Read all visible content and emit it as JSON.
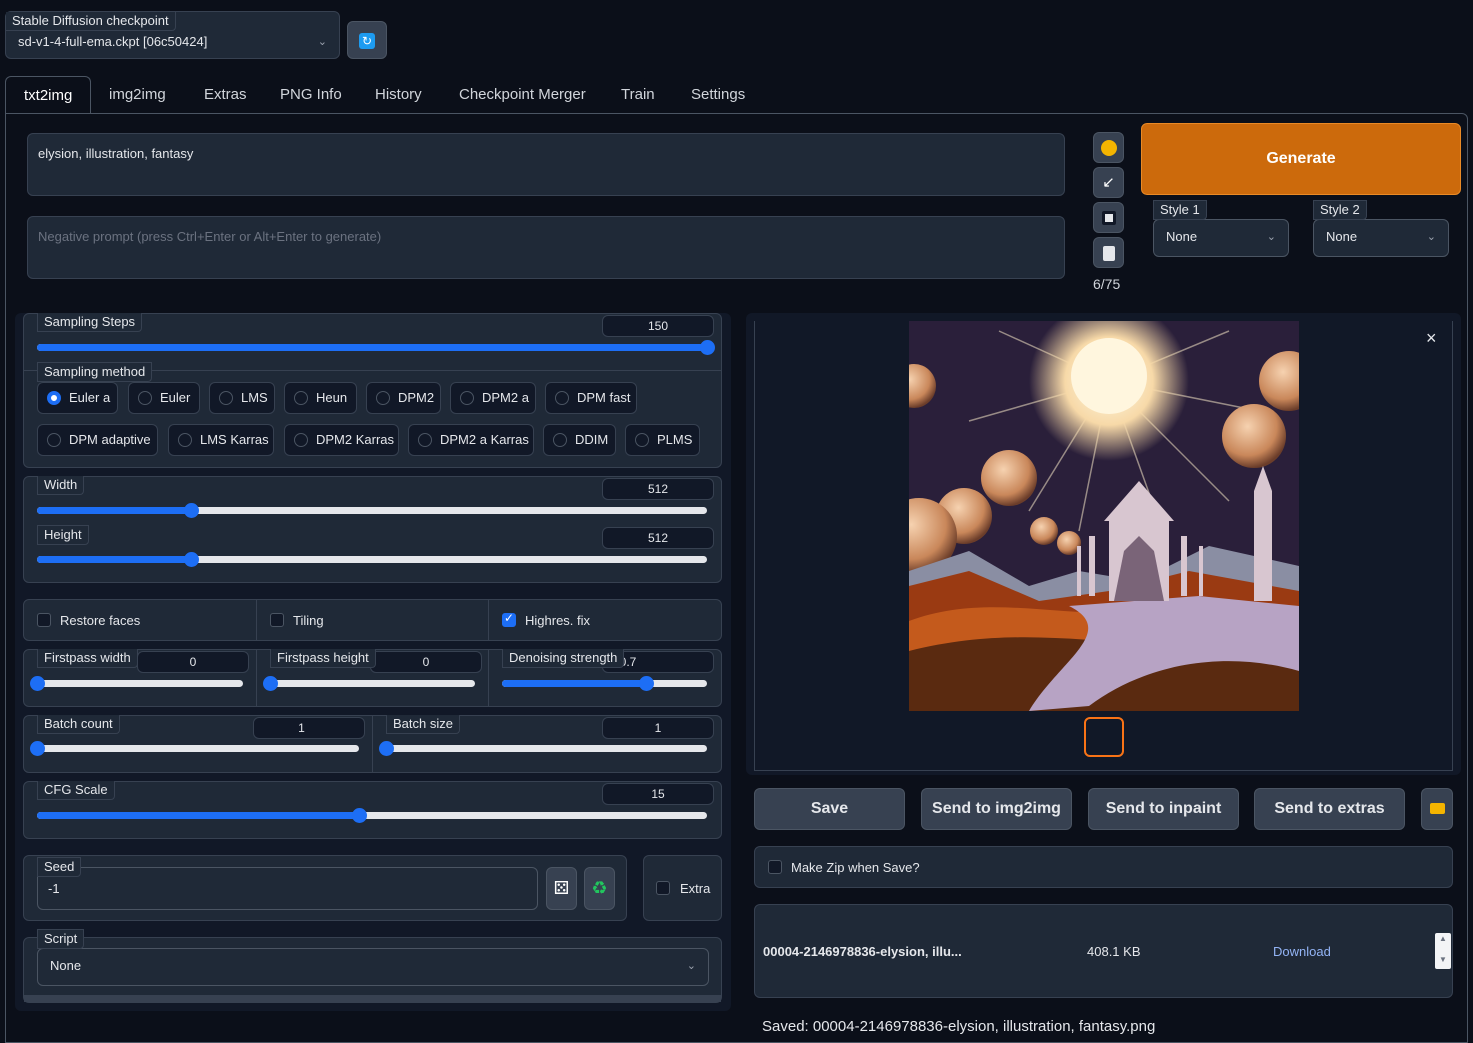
{
  "checkpoint": {
    "label": "Stable Diffusion checkpoint",
    "value": "sd-v1-4-full-ema.ckpt [06c50424]"
  },
  "tabs": [
    "txt2img",
    "img2img",
    "Extras",
    "PNG Info",
    "History",
    "Checkpoint Merger",
    "Train",
    "Settings"
  ],
  "prompt": {
    "value": "elysion, illustration, fantasy",
    "negative_placeholder": "Negative prompt (press Ctrl+Enter or Alt+Enter to generate)",
    "token_count": "6/75"
  },
  "generate_label": "Generate",
  "styles": [
    {
      "label": "Style 1",
      "value": "None"
    },
    {
      "label": "Style 2",
      "value": "None"
    }
  ],
  "sampling_steps": {
    "label": "Sampling Steps",
    "value": "150",
    "fraction": 1.0
  },
  "sampling_method": {
    "label": "Sampling method",
    "options_row1": [
      "Euler a",
      "Euler",
      "LMS",
      "Heun",
      "DPM2",
      "DPM2 a",
      "DPM fast"
    ],
    "options_row2": [
      "DPM adaptive",
      "LMS Karras",
      "DPM2 Karras",
      "DPM2 a Karras",
      "DDIM",
      "PLMS"
    ],
    "selected": "Euler a"
  },
  "width": {
    "label": "Width",
    "value": "512",
    "fraction": 0.23
  },
  "height": {
    "label": "Height",
    "value": "512",
    "fraction": 0.23
  },
  "checks": {
    "restore_faces": "Restore faces",
    "tiling": "Tiling",
    "highres": "Highres. fix",
    "make_zip": "Make Zip when Save?",
    "extra": "Extra"
  },
  "firstpass_width": {
    "label": "Firstpass width",
    "value": "0",
    "fraction": 0.0
  },
  "firstpass_height": {
    "label": "Firstpass height",
    "value": "0",
    "fraction": 0.0
  },
  "denoising": {
    "label": "Denoising strength",
    "value": "0.7",
    "fraction": 0.7
  },
  "batch_count": {
    "label": "Batch count",
    "value": "1",
    "fraction": 0.0
  },
  "batch_size": {
    "label": "Batch size",
    "value": "1",
    "fraction": 0.0
  },
  "cfg_scale": {
    "label": "CFG Scale",
    "value": "15",
    "fraction": 0.48
  },
  "seed": {
    "label": "Seed",
    "value": "-1"
  },
  "script": {
    "label": "Script",
    "value": "None"
  },
  "actions": {
    "save": "Save",
    "img2img": "Send to img2img",
    "inpaint": "Send to inpaint",
    "extras": "Send to extras"
  },
  "file": {
    "name": "00004-2146978836-elysion, illu...",
    "size": "408.1 KB",
    "download": "Download"
  },
  "saved_text": "Saved: 00004-2146978836-elysion, illustration, fantasy.png",
  "close_glyph": "×",
  "colors": {
    "accent": "#1d6ef5",
    "generate": "#cc6a0c",
    "bg": "#0b0f19",
    "panel": "#1f2937"
  }
}
